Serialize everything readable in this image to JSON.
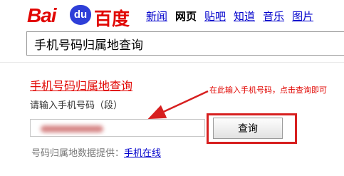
{
  "logo": {
    "text_latin": "Bai",
    "paw_text": "du",
    "text_cn": "百度",
    "colors": {
      "red": "#e10602",
      "blue": "#2e3fd8"
    }
  },
  "nav": {
    "items": [
      {
        "label": "新闻",
        "active": false
      },
      {
        "label": "网页",
        "active": true
      },
      {
        "label": "贴吧",
        "active": false
      },
      {
        "label": "知道",
        "active": false
      },
      {
        "label": "音乐",
        "active": false
      },
      {
        "label": "图片",
        "active": false
      }
    ]
  },
  "search": {
    "value": "手机号码归属地查询"
  },
  "card": {
    "title": "手机号码归属地查询",
    "prompt": "请输入手机号码（段）",
    "input_value": "",
    "submit_label": "查询",
    "provider_prefix": "号码归属地数据提供：",
    "provider_link": "手机在线"
  },
  "annotation": {
    "text": "在此输入手机号码，点击查询即可",
    "color": "#e10602"
  }
}
